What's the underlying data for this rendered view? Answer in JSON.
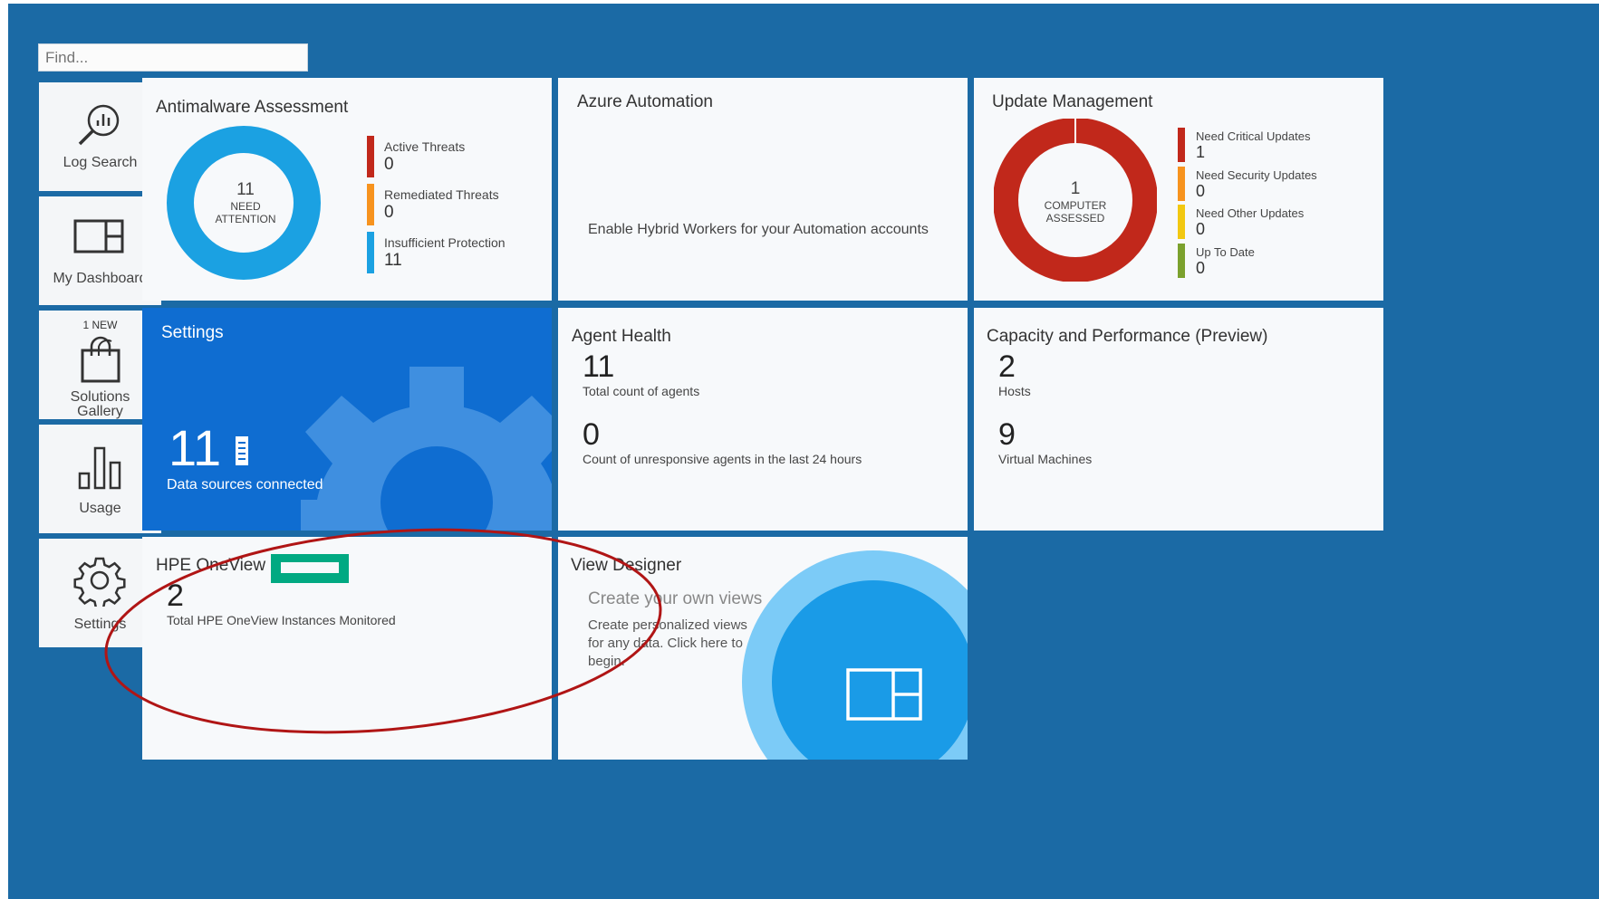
{
  "search": {
    "placeholder": "Find..."
  },
  "nav": [
    {
      "label": "Log Search"
    },
    {
      "label": "My Dashboard"
    },
    {
      "badge": "1 NEW",
      "label_line1": "Solutions",
      "label_line2": "Gallery"
    },
    {
      "label": "Usage"
    },
    {
      "label": "Settings"
    }
  ],
  "antimalware": {
    "title": "Antimalware Assessment",
    "center_value": "11",
    "center_line1": "NEED",
    "center_line2": "ATTENTION",
    "legend": [
      {
        "label": "Active Threats",
        "value": "0",
        "color": "#c1281b"
      },
      {
        "label": "Remediated Threats",
        "value": "0",
        "color": "#f7931e"
      },
      {
        "label": "Insufficient Protection",
        "value": "11",
        "color": "#1ba1e2"
      }
    ]
  },
  "azure_automation": {
    "title": "Azure Automation",
    "message": "Enable Hybrid Workers for your Automation accounts"
  },
  "update_management": {
    "title": "Update Management",
    "center_value": "1",
    "center_line1": "COMPUTER",
    "center_line2": "ASSESSED",
    "legend": [
      {
        "label": "Need Critical Updates",
        "value": "1",
        "color": "#c1281b"
      },
      {
        "label": "Need Security Updates",
        "value": "0",
        "color": "#f7931e"
      },
      {
        "label": "Need Other Updates",
        "value": "0",
        "color": "#f2c811"
      },
      {
        "label": "Up To Date",
        "value": "0",
        "color": "#7ba12d"
      }
    ]
  },
  "settings_tile": {
    "title": "Settings",
    "count": "11",
    "caption": "Data sources connected"
  },
  "agent_health": {
    "title": "Agent Health",
    "count": "11",
    "count_label": "Total count of agents",
    "unresponsive": "0",
    "unresponsive_label": "Count of unresponsive agents in the last 24 hours"
  },
  "capacity": {
    "title": "Capacity and Performance (Preview)",
    "hosts": "2",
    "hosts_label": "Hosts",
    "vms": "9",
    "vms_label": "Virtual Machines"
  },
  "hpe": {
    "title": "HPE OneView",
    "count": "2",
    "count_label": "Total HPE OneView Instances Monitored",
    "logo_color": "#01a982"
  },
  "view_designer": {
    "title": "View Designer",
    "heading": "Create your own views",
    "line1": "Create personalized views",
    "line2": "for any data. Click here to",
    "line3": "begin."
  },
  "colors": {
    "background": "#1b6aa5",
    "settings_tile": "#0f6dd1",
    "annotation": "#b01515"
  }
}
